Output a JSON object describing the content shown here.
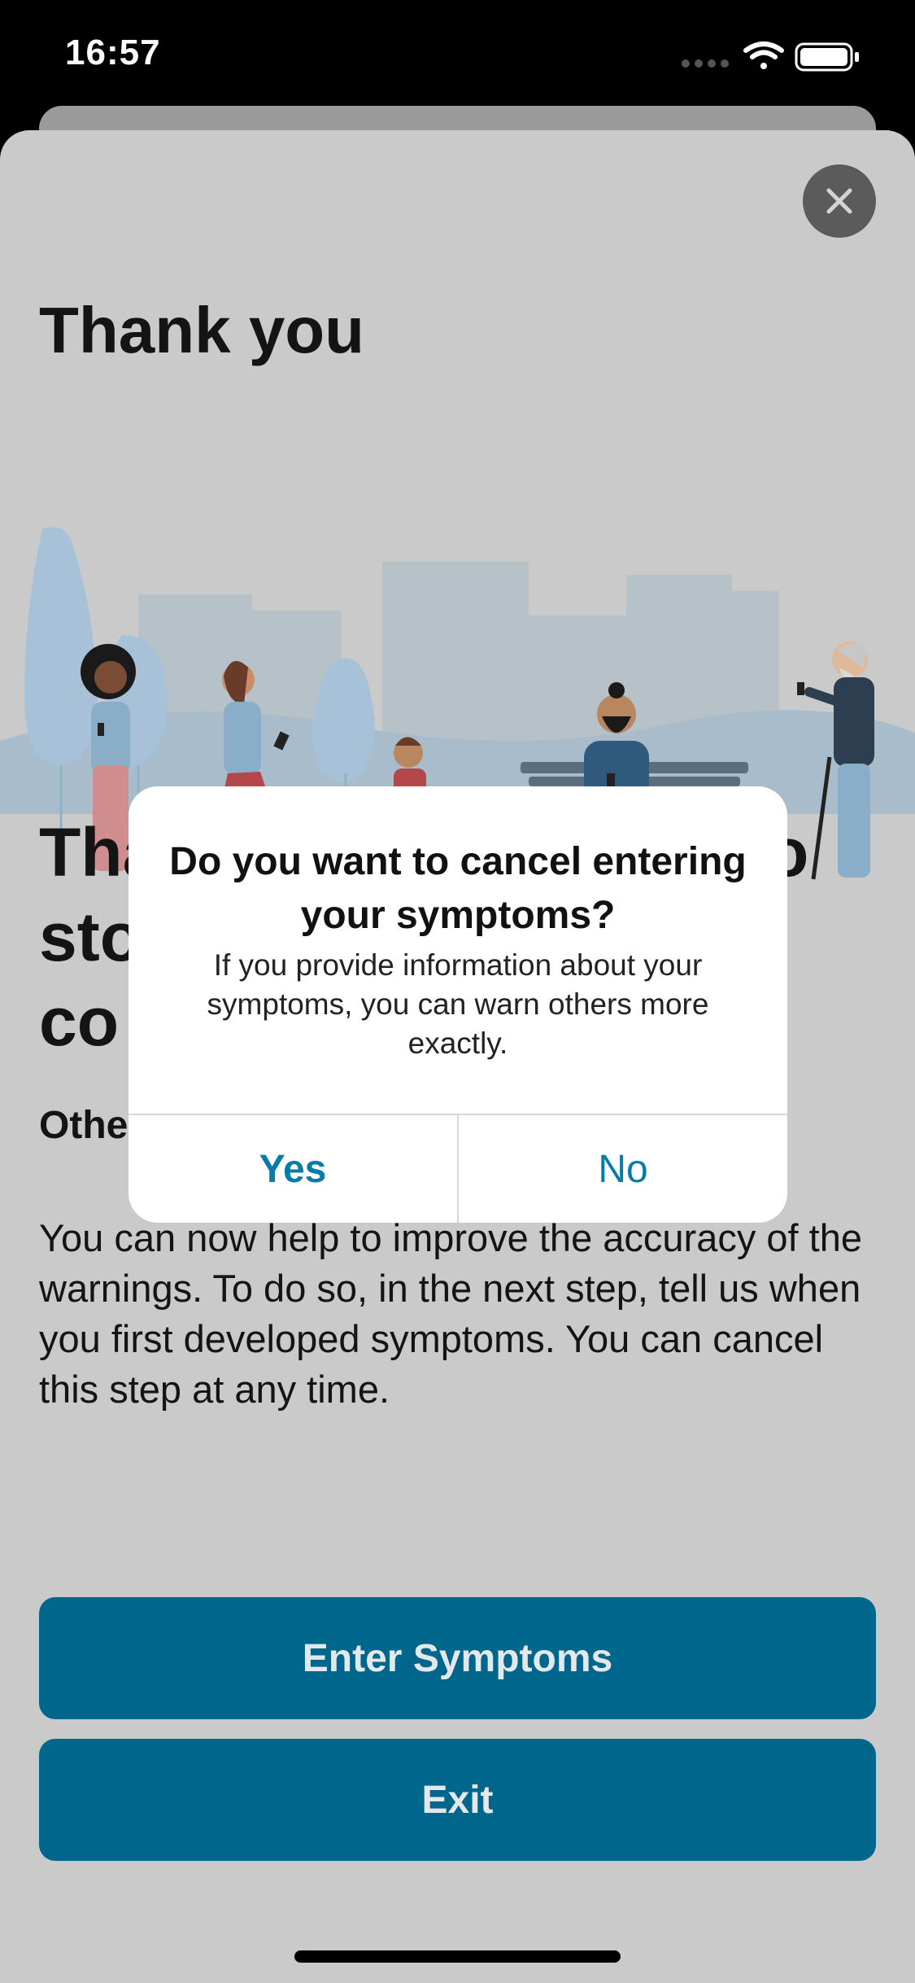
{
  "status_bar": {
    "time": "16:57"
  },
  "page": {
    "title": "Thank you",
    "heading_fragments": [
      "Tha",
      "o",
      "sto",
      "co"
    ],
    "subheading_fragment": "Othe",
    "body": "You can now help to improve the accuracy of the warnings. To do so, in the next step, tell us when you first developed symptoms. You can cancel this step at any time."
  },
  "buttons": {
    "enter_symptoms": "Enter Symptoms",
    "exit": "Exit"
  },
  "alert": {
    "title": "Do you want to cancel entering your symptoms?",
    "message": "If you provide information about your symptoms, you can warn others more exactly.",
    "yes": "Yes",
    "no": "No"
  },
  "colors": {
    "primary": "#00668c",
    "alert_button_text": "#0a7aa6",
    "sheet_background": "#cacaca"
  },
  "icons": {
    "close": "close-icon",
    "wifi": "wifi-icon",
    "battery": "battery-icon",
    "signal": "cellular-signal-icon"
  }
}
